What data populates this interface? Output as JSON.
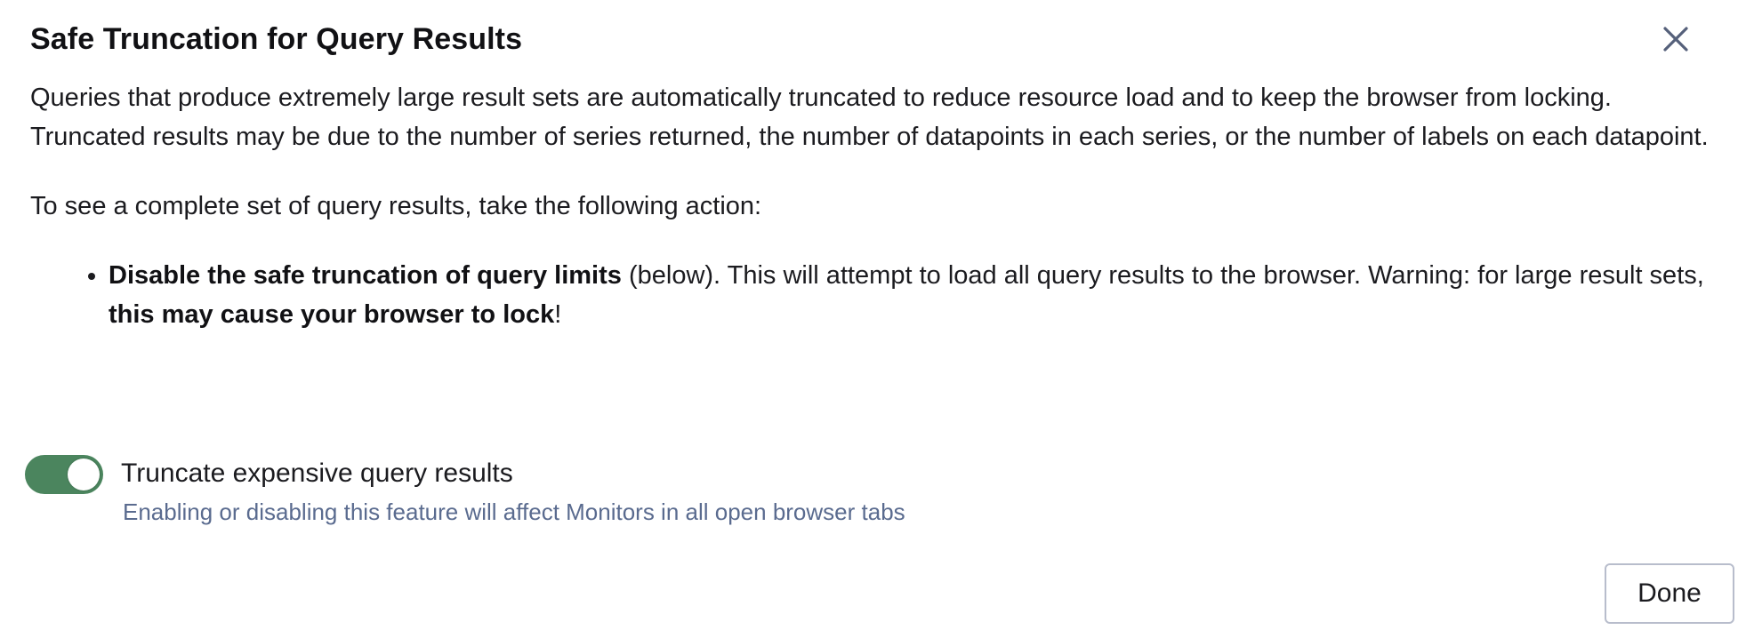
{
  "dialog": {
    "title": "Safe Truncation for Query Results",
    "close_icon": "close-icon",
    "paragraph_1": "Queries that produce extremely large result sets are automatically truncated to reduce resource load and to keep the browser from locking. Truncated results may be due to the number of series returned, the number of datapoints in each series, or the number of labels on each datapoint.",
    "paragraph_2": "To see a complete set of query results, take the following action:",
    "bullet": {
      "bold_1": "Disable the safe truncation of query limits",
      "text_1": " (below). This will attempt to load all query results to the browser. Warning: for large result sets, ",
      "bold_2": "this may cause your browser to lock",
      "text_2": "!"
    },
    "toggle": {
      "label": "Truncate expensive query results",
      "helper": "Enabling or disabling this feature will affect Monitors in all open browser tabs",
      "state": "on",
      "color": "#4b855e"
    },
    "done_label": "Done"
  }
}
